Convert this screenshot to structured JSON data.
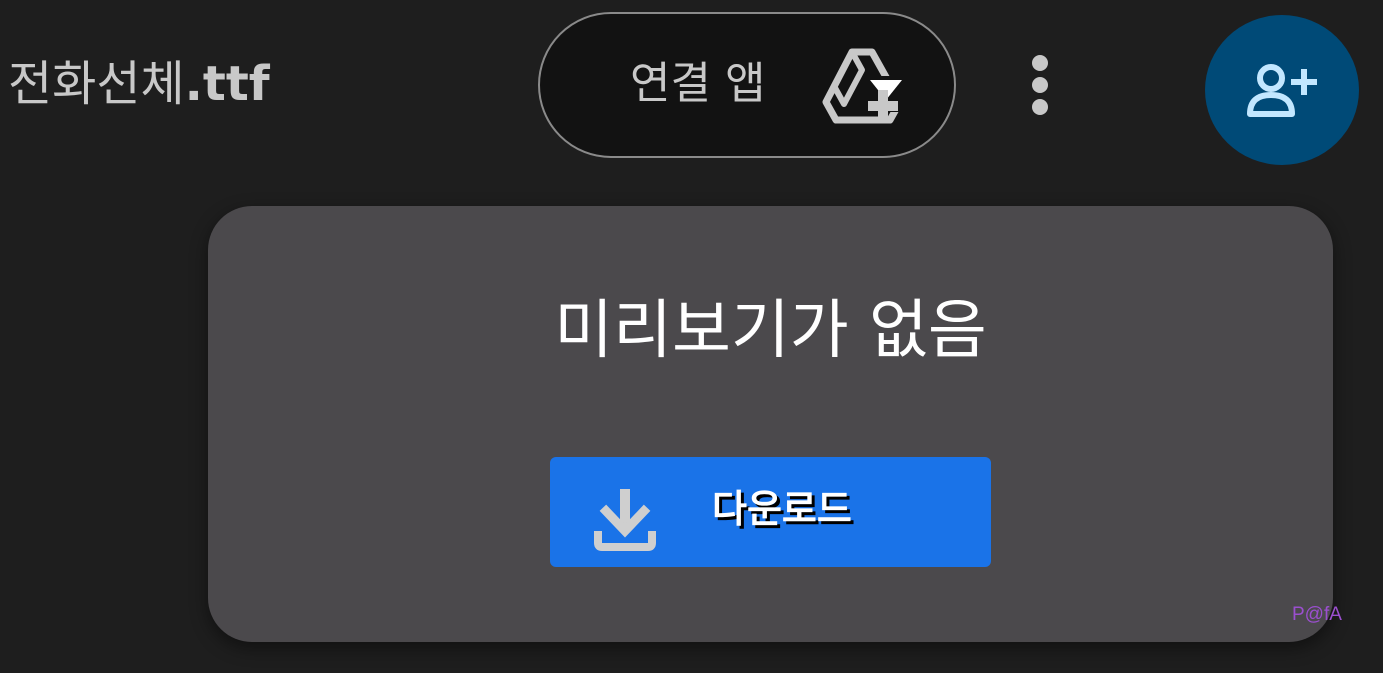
{
  "header": {
    "file_name": "전화선체",
    "file_ext": ".ttf",
    "open_with_label": "연결 앱",
    "open_with_icon": "open-with-app-icon",
    "more_icon": "more-vert-icon",
    "share_icon": "person-add-icon"
  },
  "preview": {
    "message": "미리보기가 없음",
    "download_label": "다운로드",
    "download_icon": "download-icon"
  },
  "watermark": "P@fA",
  "colors": {
    "background": "#1e1e1e",
    "card": "#4b494c",
    "accent": "#1a73e8",
    "share_button": "#004a77",
    "share_icon": "#c2e7ff"
  }
}
